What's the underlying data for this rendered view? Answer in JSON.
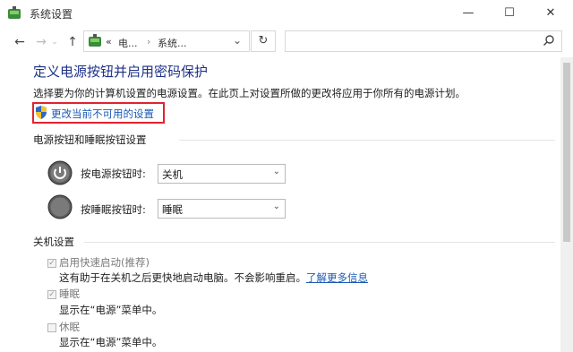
{
  "window": {
    "title": "系统设置",
    "minimize": "—",
    "maximize": "☐",
    "close": "✕"
  },
  "nav": {
    "back": "←",
    "forward": "→",
    "up": "↑",
    "breadcrumb_sep": "«",
    "crumb1": "电...",
    "crumb2": "系统...",
    "dropdown": "⌄",
    "refresh": "↻",
    "search_placeholder": ""
  },
  "page": {
    "heading": "定义电源按钮并启用密码保护",
    "description": "选择要为你的计算机设置的电源设置。在此页上对设置所做的更改将应用于你所有的电源计划。",
    "change_link": "更改当前不可用的设置"
  },
  "power_section": {
    "title": "电源按钮和睡眠按钮设置",
    "power_button_label": "按电源按钮时:",
    "power_button_value": "关机",
    "sleep_button_label": "按睡眠按钮时:",
    "sleep_button_value": "睡眠"
  },
  "shutdown_section": {
    "title": "关机设置",
    "options": [
      {
        "label": "启用快速启动(推荐)",
        "checked": true,
        "desc": "这有助于在关机之后更快地启动电脑。不会影响重启。",
        "link": "了解更多信息"
      },
      {
        "label": "睡眠",
        "checked": true,
        "desc": "显示在“电源”菜单中。"
      },
      {
        "label": "休眠",
        "checked": false,
        "desc": "显示在“电源”菜单中。"
      }
    ]
  },
  "colors": {
    "heading": "#1e3287",
    "link": "#1a5ab4",
    "highlight_border": "#e0232f"
  }
}
